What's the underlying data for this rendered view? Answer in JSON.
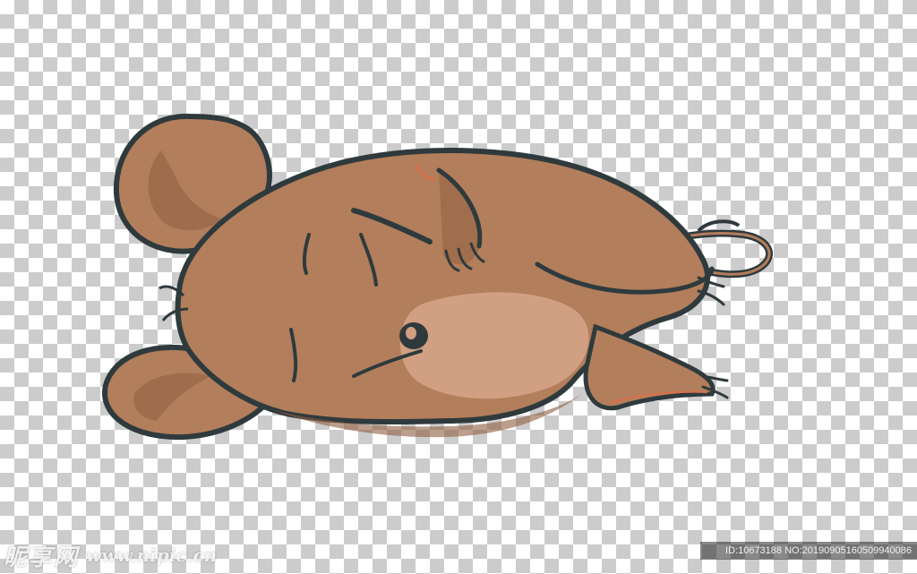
{
  "image": {
    "subject": "cartoon-brown-mouse-lying-down-icon",
    "background": "transparency-checkerboard",
    "colors": {
      "fur": "#b27e5b",
      "fur_shadow": "#8f5e40",
      "ear_inner": "#c48a66",
      "belly": "#d19f82",
      "outline": "#2f3a3d",
      "accent_orange": "#d9714a"
    }
  },
  "watermark": {
    "site_name": "昵享网",
    "site_url": "www.nipic.cn",
    "id_line": "ID:10673188 NO:20190905160509940086"
  }
}
